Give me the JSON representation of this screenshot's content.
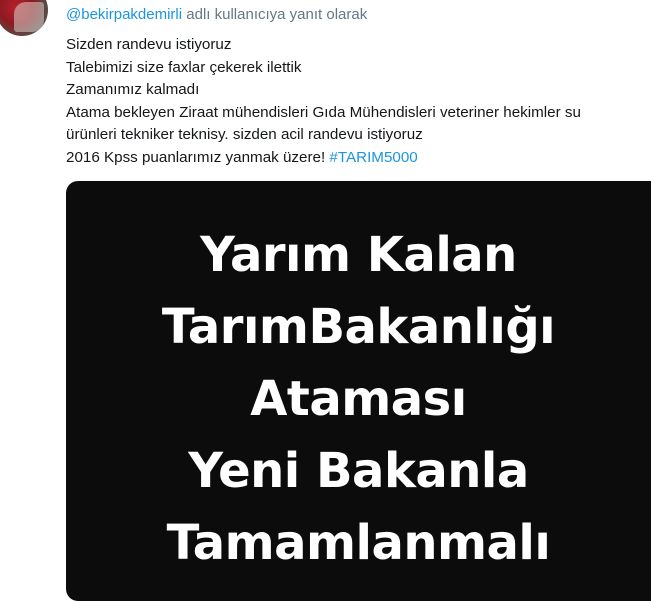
{
  "reply": {
    "mention": "@bekirpakdemirli",
    "suffix": " adlı kullanıcıya yanıt olarak"
  },
  "tweet": {
    "lines": [
      "Sizden randevu istiyoruz",
      "Talebimizi size faxlar çekerek ilettik",
      "Zamanımız kalmadı",
      "Atama bekleyen Ziraat mühendisleri Gıda Mühendisleri veteriner hekimler su",
      "ürünleri tekniker teknisy. sizden acil randevu istiyoruz"
    ],
    "last_line_prefix": "2016 Kpss puanlarımız yanmak üzere! ",
    "hashtag": "#TARIM5000"
  },
  "media": {
    "lines": [
      "Yarım Kalan",
      "TarımBakanlığı",
      "Ataması",
      "Yeni Bakanla",
      "Tamamlanmalı"
    ]
  }
}
